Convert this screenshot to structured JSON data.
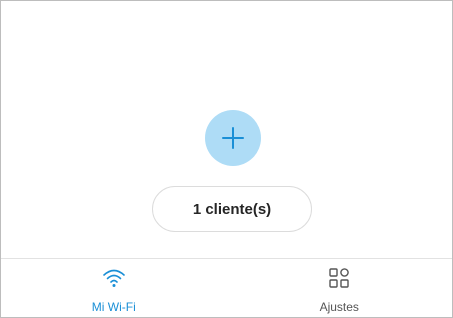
{
  "main": {
    "add_button_icon": "plus-icon",
    "clients_label": "1 cliente(s)"
  },
  "tabs": [
    {
      "label": "Mi Wi-Fi",
      "icon": "wifi-icon",
      "active": true
    },
    {
      "label": "Ajustes",
      "icon": "grid-icon",
      "active": false
    }
  ],
  "colors": {
    "accent": "#1a8fd6",
    "add_button_bg": "#aedcf6",
    "inactive_text": "#555555"
  }
}
